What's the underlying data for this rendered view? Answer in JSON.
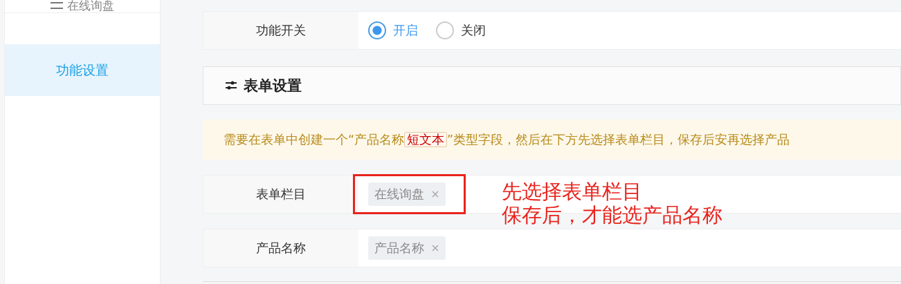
{
  "sidebar": {
    "items": [
      {
        "label": "在线询盘",
        "selected": false
      },
      {
        "label": "功能设置",
        "selected": true
      }
    ]
  },
  "switch_row": {
    "label": "功能开关",
    "options": [
      {
        "label": "开启",
        "selected": true
      },
      {
        "label": "关闭",
        "selected": false
      }
    ]
  },
  "section": {
    "title": "表单设置"
  },
  "notice": {
    "before": "需要在表单中创建一个“产品名称",
    "tag": "短文本",
    "after": "”类型字段，然后在下方先选择表单栏目，保存后安再选择产品"
  },
  "fields": [
    {
      "label": "表单栏目",
      "tags": [
        "在线询盘"
      ],
      "highlighted": true
    },
    {
      "label": "产品名称",
      "tags": [
        "产品名称"
      ],
      "highlighted": false
    }
  ],
  "annotation": {
    "lines": [
      "先选择表单栏目",
      "保存后，才能选产品名称"
    ]
  }
}
